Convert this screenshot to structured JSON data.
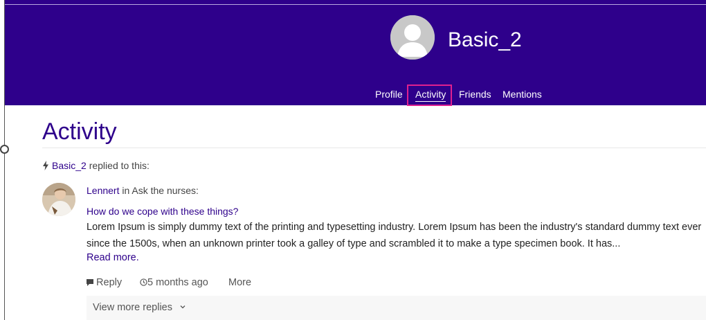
{
  "header": {
    "username": "Basic_2",
    "nav": [
      {
        "label": "Profile"
      },
      {
        "label": "Activity"
      },
      {
        "label": "Friends"
      },
      {
        "label": "Mentions"
      }
    ],
    "active_tab": "Activity",
    "bg_color": "#2e008b",
    "highlight_color": "#e0208f"
  },
  "page": {
    "title": "Activity"
  },
  "activity": {
    "actor": "Basic_2",
    "action_text": " replied to this:",
    "post": {
      "author": "Lennert",
      "in_text": " in Ask the nurses:",
      "title": "How do we cope with these things?",
      "body": "Lorem Ipsum is simply dummy text of the printing and typesetting industry. Lorem Ipsum has been the industry's standard dummy text ever since the 1500s, when an unknown printer took a galley of type and scrambled it to make a type specimen book. It has...",
      "read_more": "Read more.",
      "actions": {
        "reply": "Reply",
        "time": "5 months ago",
        "more": "More"
      },
      "view_more_replies": "View more replies"
    }
  },
  "icons": {
    "bolt": "bolt-icon",
    "reply": "comment-icon",
    "clock": "clock-icon",
    "chevron": "chevron-down-icon"
  }
}
